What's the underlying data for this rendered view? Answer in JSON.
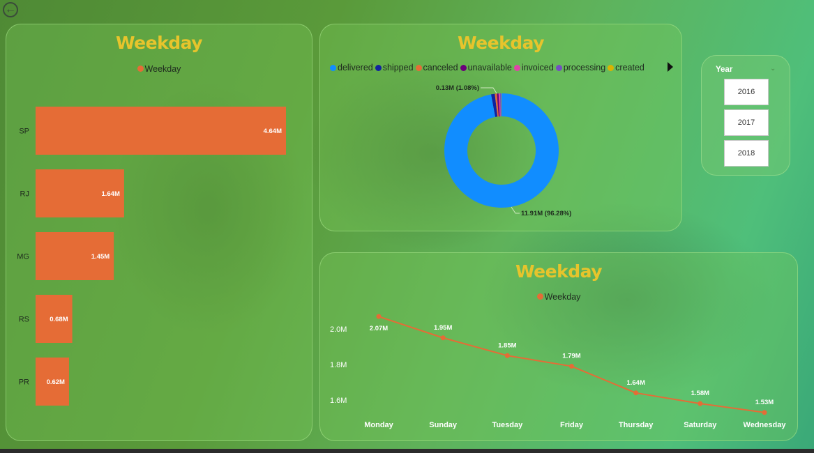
{
  "nav": {
    "back_icon": "back-arrow-icon"
  },
  "colors": {
    "title": "#e7c42c",
    "bar": "#e56c36",
    "line": "#e56c36",
    "delivered": "#118dff",
    "shipped": "#12239e",
    "canceled": "#e66c37",
    "unavailable": "#6b007b",
    "invoiced": "#e044a7",
    "processing": "#744ec2",
    "created": "#d9b300"
  },
  "year_slicer": {
    "title": "Year",
    "chevron_icon": "chevron-down-icon",
    "options": [
      "2016",
      "2017",
      "2018"
    ]
  },
  "chart_data": [
    {
      "type": "bar",
      "orientation": "horizontal",
      "title": "Weekday",
      "legend": [
        "Weekday"
      ],
      "categories": [
        "SP",
        "RJ",
        "MG",
        "RS",
        "PR"
      ],
      "values": [
        4.64,
        1.64,
        1.45,
        0.68,
        0.62
      ],
      "labels": [
        "4.64M",
        "1.64M",
        "1.45M",
        "0.68M",
        "0.62M"
      ],
      "unit": "M"
    },
    {
      "type": "pie",
      "style": "donut",
      "title": "Weekday",
      "legend": [
        "delivered",
        "shipped",
        "canceled",
        "unavailable",
        "invoiced",
        "processing",
        "created"
      ],
      "legend_more_icon": "triangle-right-icon",
      "values": [
        11.91,
        0.13,
        0.07,
        0.06,
        0.05,
        0.04,
        0.01
      ],
      "labels": {
        "delivered": "11.91M (96.28%)",
        "shipped": "0.13M (1.08%)"
      }
    },
    {
      "type": "line",
      "title": "Weekday",
      "legend": [
        "Weekday"
      ],
      "categories": [
        "Monday",
        "Sunday",
        "Tuesday",
        "Friday",
        "Thursday",
        "Saturday",
        "Wednesday"
      ],
      "values": [
        2.07,
        1.95,
        1.85,
        1.79,
        1.64,
        1.58,
        1.53
      ],
      "labels": [
        "2.07M",
        "1.95M",
        "1.85M",
        "1.79M",
        "1.64M",
        "1.58M",
        "1.53M"
      ],
      "yticks": [
        "2.0M",
        "1.8M",
        "1.6M"
      ],
      "ytick_values": [
        2.0,
        1.8,
        1.6
      ],
      "ylim": [
        1.5,
        2.1
      ]
    }
  ]
}
